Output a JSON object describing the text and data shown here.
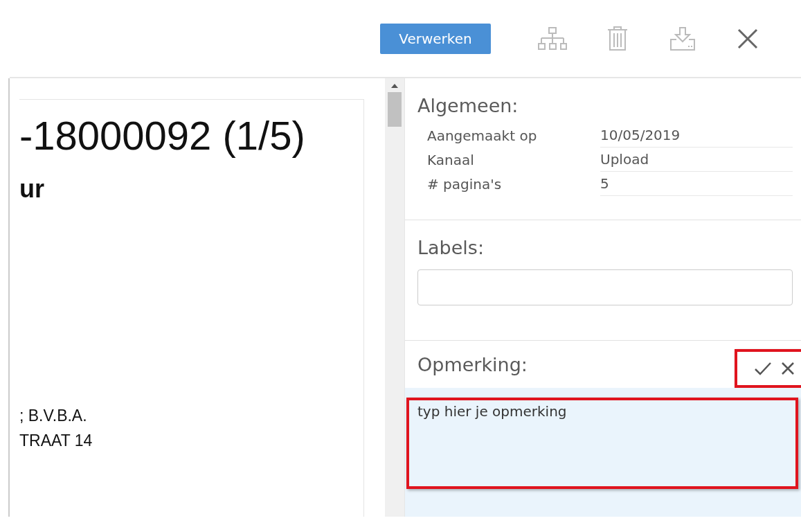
{
  "toolbar": {
    "process_button": "Verwerken",
    "icons": [
      {
        "kind": "hierarchy"
      },
      {
        "kind": "trash"
      },
      {
        "kind": "download"
      },
      {
        "kind": "close"
      }
    ]
  },
  "document": {
    "lines": [
      {
        "kind": "title",
        "text": "-18000092 (1/5)"
      },
      {
        "kind": "heading",
        "text": "ur"
      },
      {
        "kind": "body",
        "text": "; B.V.B.A."
      },
      {
        "kind": "body",
        "text": "TRAAT 14"
      }
    ]
  },
  "general": {
    "title": "Algemeen:",
    "rows": [
      {
        "label": "Aangemaakt op",
        "value": "10/05/2019"
      },
      {
        "label": "Kanaal",
        "value": "Upload"
      },
      {
        "label": "# pagina's",
        "value": "5"
      }
    ]
  },
  "labels": {
    "title": "Labels:"
  },
  "comment": {
    "title": "Opmerking:",
    "value": "typ hier je opmerking",
    "actions_highlighted": true,
    "field_highlighted": true
  }
}
